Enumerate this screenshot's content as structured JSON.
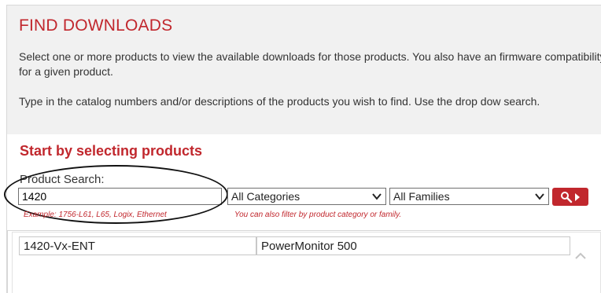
{
  "header": {
    "title": "FIND DOWNLOADS",
    "intro_1": "Select one or more products to view the available downloads for those products. You also have an firmware compatibility for a given product.",
    "intro_2": "Type in the catalog numbers and/or descriptions of the products you wish to find. Use the drop dow search."
  },
  "search": {
    "section_title": "Start by selecting products",
    "label": "Product Search:",
    "value": "1420",
    "example_hint": "Example: 1756-L61, L65, Logix, Ethernet",
    "category_select": "All Categories",
    "family_select": "All Families",
    "filter_hint": "You can also filter by product category or family.",
    "button_icons": [
      "magnifier-icon",
      "arrow-right-icon"
    ]
  },
  "results": {
    "rows": [
      {
        "catalog": "1420-Vx-ENT",
        "description": "PowerMonitor 500"
      }
    ]
  },
  "colors": {
    "accent": "#c1272d",
    "panel_bg": "#f1f1f1",
    "text": "#333333"
  }
}
